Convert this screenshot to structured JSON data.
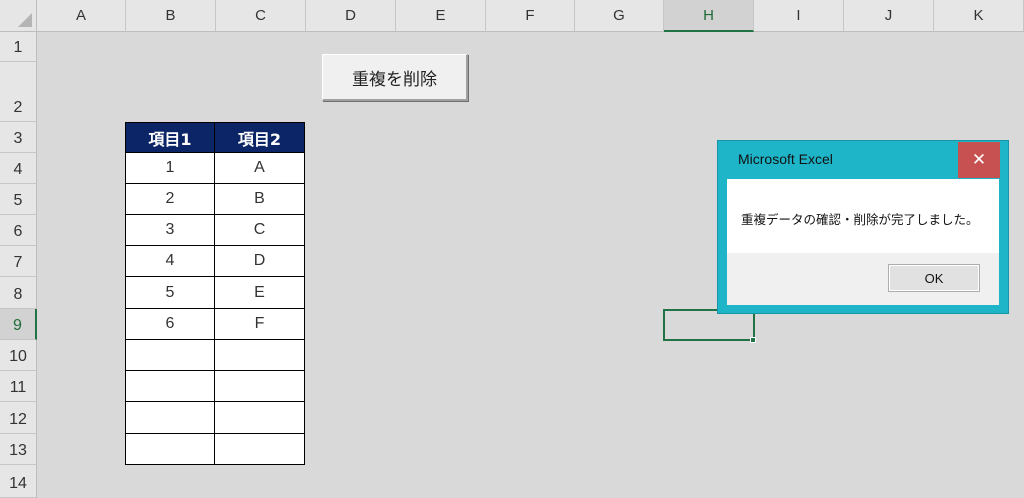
{
  "columns": [
    "A",
    "B",
    "C",
    "D",
    "E",
    "F",
    "G",
    "H",
    "I",
    "J",
    "K"
  ],
  "rows": [
    "1",
    "2",
    "3",
    "4",
    "5",
    "6",
    "7",
    "8",
    "9",
    "10",
    "11",
    "12",
    "13",
    "14"
  ],
  "active_column": "H",
  "active_row": "9",
  "macro_button_label": "重複を削除",
  "table": {
    "headers": [
      "項目1",
      "項目2"
    ],
    "rows": [
      [
        "1",
        "A"
      ],
      [
        "2",
        "B"
      ],
      [
        "3",
        "C"
      ],
      [
        "4",
        "D"
      ],
      [
        "5",
        "E"
      ],
      [
        "6",
        "F"
      ],
      [
        "",
        ""
      ],
      [
        "",
        ""
      ],
      [
        "",
        ""
      ],
      [
        "",
        ""
      ]
    ]
  },
  "dialog": {
    "title": "Microsoft Excel",
    "close_glyph": "✕",
    "message": "重複データの確認・削除が完了しました。",
    "ok_label": "OK"
  },
  "colors": {
    "header_fill": "#0c2566",
    "selection": "#217346",
    "dialog_frame": "#1fb5c9",
    "close_button": "#c75050"
  }
}
